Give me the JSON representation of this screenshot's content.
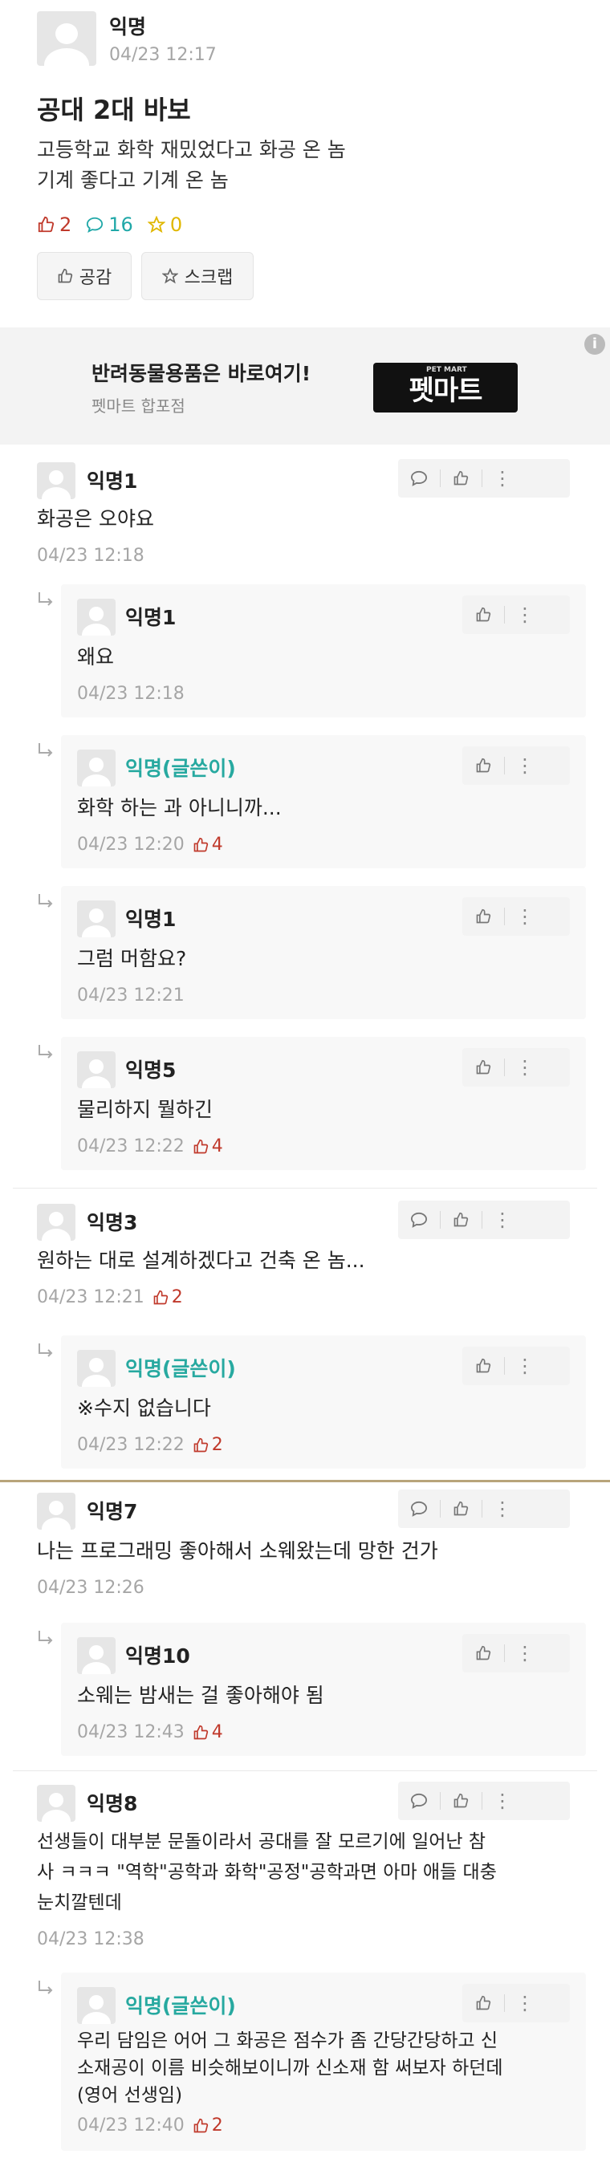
{
  "post": {
    "author": "익명",
    "date": "04/23 12:17",
    "title": "공대 2대 바보",
    "body": [
      "고등학교 화학 재밌었다고 화공 온 놈",
      "기계 좋다고 기계 온 놈"
    ],
    "likes": "2",
    "comments": "16",
    "scraps": "0",
    "like_button": "공감",
    "scrap_button": "스크랩"
  },
  "ad": {
    "title": "반려동물용품은 바로여기!",
    "subtitle": "펫마트 합포점",
    "logo_text": "펫마트",
    "logo_small": "PET MART",
    "info_icon": "info-icon"
  },
  "comments": [
    {
      "name": "익명1",
      "text": "화공은 오야요",
      "date": "04/23 12:18",
      "likes": ""
    },
    {
      "name": "익명1",
      "text": "왜요",
      "date": "04/23 12:18",
      "likes": ""
    },
    {
      "name": "익명(글쓴이)",
      "text": "화학 하는 과 아니니까...",
      "date": "04/23 12:20",
      "likes": "4"
    },
    {
      "name": "익명1",
      "text": "그럼 머함요?",
      "date": "04/23 12:21",
      "likes": ""
    },
    {
      "name": "익명5",
      "text": "물리하지 뭘하긴",
      "date": "04/23 12:22",
      "likes": "4"
    },
    {
      "name": "익명3",
      "text": "원하는 대로 설계하겠다고 건축 온 놈...",
      "date": "04/23 12:21",
      "likes": "2"
    },
    {
      "name": "익명(글쓴이)",
      "text": "※수지 없습니다",
      "date": "04/23 12:22",
      "likes": "2"
    },
    {
      "name": "익명7",
      "text": "나는 프로그래밍 좋아해서 소웨왔는데 망한 건가",
      "date": "04/23 12:26",
      "likes": ""
    },
    {
      "name": "익명10",
      "text": "소웨는 밤새는 걸 좋아해야 됨",
      "date": "04/23 12:43",
      "likes": "4"
    },
    {
      "name": "익명8",
      "text": [
        "선생들이 대부분 문돌이라서 공대를 잘 모르기에 일어난 참",
        "사 ㅋㅋㅋ \"역학\"공학과 화학\"공정\"공학과면 아마 애들 대충",
        "눈치깔텐데"
      ],
      "date": "04/23 12:38",
      "likes": ""
    },
    {
      "name": "익명(글쓴이)",
      "text": [
        "우리 담임은 어어 그 화공은 점수가 좀 간당간당하고 신",
        "소재공이 이름 비슷해보이니까 신소재 함 써보자 하던데",
        "(영어 선생임)"
      ],
      "date": "04/23 12:40",
      "likes": "2"
    }
  ]
}
